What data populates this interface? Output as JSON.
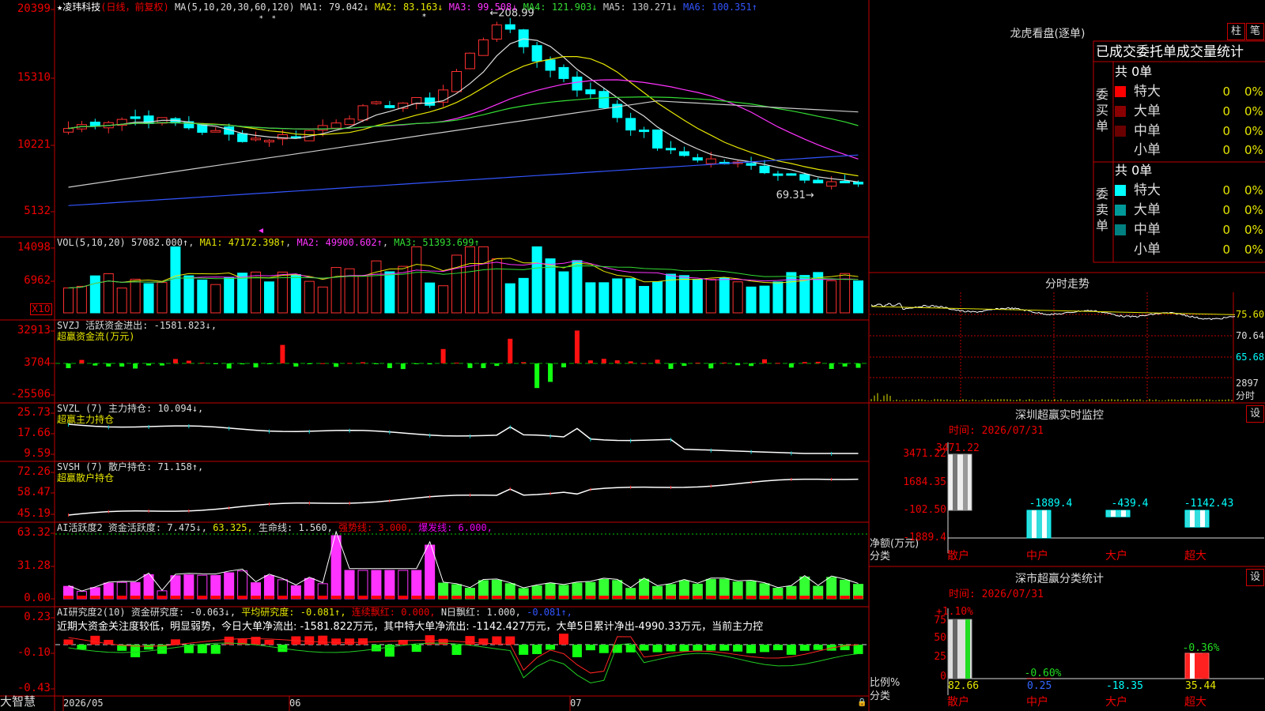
{
  "stock": {
    "star": "★",
    "name": "凌玮科技",
    "mode": "(日线，前复权)"
  },
  "main": {
    "ma_label": "MA(5,10,20,30,60,120)",
    "ma_values": [
      {
        "text": "MA1: 79.042↓",
        "color": "#dddddd"
      },
      {
        "text": "MA2: 83.163↓",
        "color": "#e6e600"
      },
      {
        "text": "MA3: 99.508↓",
        "color": "#ff33ff"
      },
      {
        "text": "MA4: 121.903↓",
        "color": "#33dd33"
      },
      {
        "text": "MA5: 130.271↓",
        "color": "#cccccc"
      },
      {
        "text": "MA6: 100.351↑",
        "color": "#3355ff"
      }
    ],
    "ticks": [
      "20399",
      "15310",
      "10221",
      "5132"
    ],
    "high_label": "208.99",
    "low_label": "69.31"
  },
  "vol": {
    "title": "VOL(5,10,20)",
    "value": "57082.000↑",
    "ma1": "MA1: 47172.398↑",
    "ma2": "MA2: 49900.602↑",
    "ma3": "MA3: 51393.699↑",
    "ticks": [
      "14098",
      "6962"
    ],
    "unit": "X10"
  },
  "svzj": {
    "title": "SVZJ",
    "line": "活跃资金进出: -1581.823↓,",
    "sub": "超赢资金流(万元)",
    "ticks": [
      "32913",
      "3704",
      "-25506"
    ]
  },
  "svzl": {
    "title": "SVZL (7)",
    "line": "主力持仓: 10.094↓,",
    "sub": "超赢主力持仓",
    "ticks": [
      "25.73",
      "17.66",
      "9.59"
    ]
  },
  "svsh": {
    "title": "SVSH (7)",
    "line": "散户持仓: 71.158↑,",
    "sub": "超赢散户持仓",
    "ticks": [
      "72.26",
      "58.47",
      "45.19"
    ]
  },
  "ai1": {
    "title": "AI活跃度2",
    "p1": "资金活跃度: 7.475↓,",
    "p2": "63.325,",
    "p3": "生命线: 1.560,",
    "p4": "强势线: 3.000,",
    "p5": "爆发线: 6.000,",
    "ticks": [
      "63.32",
      "31.28",
      "0.00"
    ]
  },
  "ai2": {
    "title": "AI研究度2(10)",
    "p1": "资金研究度: -0.063↓,",
    "p2": "平均研究度: -0.081↑,",
    "p3": "连续飘红: 0.000,",
    "p4": "N日飘红: 1.000,",
    "p5": "-0.081↑,",
    "comment": "近期大资金关注度较低，明显弱势，今日大单净流出: -1581.822万元，其中特大单净流出: -1142.427万元，大单5日累计净出-4990.33万元，当前主力控",
    "ticks": [
      "0.23",
      "-0.10",
      "-0.43"
    ]
  },
  "xaxis": {
    "brand": "大智慧",
    "dates": [
      "2026/05",
      "06",
      "07"
    ]
  },
  "lhb": {
    "title": "龙虎看盘(逐单)",
    "btn_col": "柱",
    "btn_pen": "笔",
    "header": "已成交委托单成交量统计",
    "buy": {
      "side": "委买单",
      "total": "共 0单",
      "rows": [
        {
          "label": "特大",
          "count": "0",
          "pct": "0%",
          "color": "#ff0000"
        },
        {
          "label": "大单",
          "count": "0",
          "pct": "0%",
          "color": "#8b0000"
        },
        {
          "label": "中单",
          "count": "0",
          "pct": "0%",
          "color": "#6a0000"
        },
        {
          "label": "小单",
          "count": "0",
          "pct": "0%",
          "color": ""
        }
      ]
    },
    "sell": {
      "side": "委卖单",
      "total": "共 0单",
      "rows": [
        {
          "label": "特大",
          "count": "0",
          "pct": "0%",
          "color": "#00ffff"
        },
        {
          "label": "大单",
          "count": "0",
          "pct": "0%",
          "color": "#009999"
        },
        {
          "label": "中单",
          "count": "0",
          "pct": "0%",
          "color": "#008080"
        },
        {
          "label": "小单",
          "count": "0",
          "pct": "0%",
          "color": ""
        }
      ]
    }
  },
  "fenshi": {
    "title": "分时走势",
    "ticks": [
      "75.60",
      "70.64",
      "65.68",
      "2897",
      "分时"
    ]
  },
  "monitor": {
    "title": "深圳超赢实时监控",
    "btn": "设",
    "time": "时间: 2026/07/31",
    "ticks": [
      "3471.22",
      "1684.35",
      "-102.50",
      "-1889.4"
    ],
    "ylabel1": "净额(万元)",
    "ylabel2": "分类",
    "bars": [
      {
        "cat": "散户",
        "value": 3471.22,
        "label": "3471.22"
      },
      {
        "cat": "中户",
        "value": -1889.4,
        "label": "-1889.4"
      },
      {
        "cat": "大户",
        "value": -439.4,
        "label": "-439.4"
      },
      {
        "cat": "超大",
        "value": -1142.43,
        "label": "-1142.43"
      }
    ]
  },
  "classify": {
    "title": "深市超赢分类统计",
    "btn": "设",
    "time": "时间: 2026/07/31",
    "ticks": [
      "75",
      "50",
      "25",
      "0"
    ],
    "ylabel1": "比例%",
    "ylabel2": "分类",
    "bars": [
      {
        "cat": "散户",
        "ratio": 82.66,
        "value": "82.66",
        "change": "+1.10%"
      },
      {
        "cat": "中户",
        "ratio": 0.25,
        "value": "0.25",
        "change": "-0.60%"
      },
      {
        "cat": "大户",
        "ratio": 0,
        "value": "-18.35",
        "change": ""
      },
      {
        "cat": "超大",
        "ratio": 35.44,
        "value": "35.44",
        "change": "-0.36%"
      }
    ]
  }
}
